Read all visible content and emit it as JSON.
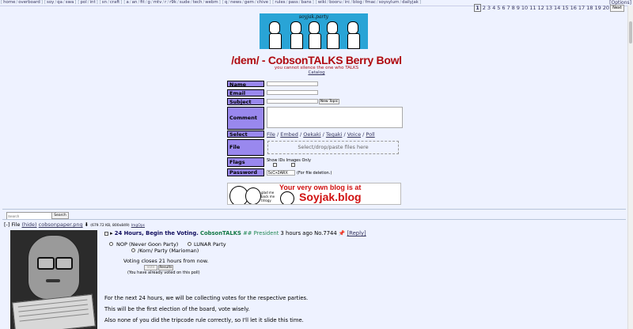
{
  "nav": {
    "groups": [
      [
        "home",
        "overboard"
      ],
      [
        "soy",
        "qa",
        "swa"
      ],
      [
        "pol",
        "int"
      ],
      [
        "sn",
        "craft"
      ],
      [
        "a",
        "an",
        "fit",
        "g",
        "mtv",
        "r",
        "r9k",
        "sude",
        "tech",
        "webm"
      ],
      [
        "q",
        "news",
        "gem",
        "chive"
      ],
      [
        "rules",
        "pass",
        "bans"
      ],
      [
        "wiki",
        "booru",
        "irc",
        "blog",
        "fmac",
        "soysylum",
        "dailyjak"
      ]
    ],
    "options_label": "[Options]",
    "pages": [
      "1",
      "2",
      "3",
      "4",
      "5",
      "6",
      "7",
      "8",
      "9",
      "10",
      "11",
      "12",
      "13",
      "14",
      "15",
      "16",
      "17",
      "18",
      "19",
      "20"
    ],
    "current_page": "1",
    "page_button": "Next"
  },
  "banner": {
    "text": "soyjak.party"
  },
  "board": {
    "title": "/dem/ - CobsonTALKS Berry Bowl",
    "subtitle": "you cannot silence the one who TALKS",
    "catalog_link": "Catalog"
  },
  "form": {
    "name_label": "Name",
    "email_label": "Email",
    "subject_label": "Subject",
    "new_topic_button": "New Topic",
    "comment_label": "Comment",
    "select_label": "Select",
    "select_links": [
      "File",
      "Embed",
      "Oekaki",
      "Tegaki",
      "Voice",
      "Poll"
    ],
    "file_label": "File",
    "dropzone_text": "Select/drop/paste files here",
    "flags_label": "Flags",
    "flags_text": "Show IDs   Images Only",
    "password_label": "Password",
    "password_value": "5cC+2ARX",
    "password_note": "(For file deletion.)"
  },
  "ad": {
    "headline": "Your very own blog is at",
    "brand": "Soyjak.blog",
    "small_text": "glad me back me trilogy"
  },
  "search": {
    "placeholder": "Search",
    "value": "",
    "button": "Search"
  },
  "thread": {
    "file_prefix": "File",
    "file_hide": "(hide)",
    "filename": "cobsonpaper.png",
    "file_meta": "(679.72 KB, 800x849)",
    "file_imgops": "ImgOps",
    "subject": "24 Hours, Begin the Voting.",
    "name": "CobsonTALKS",
    "tripcode": "## President",
    "time": "3 hours ago",
    "post_no": "No.7744",
    "reply_label": "[Reply]",
    "poll": {
      "options": [
        "NOP (Never Goon Party)",
        "LUNAR Party",
        "/Korn/ Party (Marioman)"
      ],
      "closes_text": "Voting closes 21 hours from now.",
      "vote_button": "Vote",
      "results_button": "Results",
      "voted_note": "(You have already voted on this poll)"
    },
    "body": [
      "For the next 24 hours, we will be collecting votes for the respective parties.",
      "This will be the first election of the board, vote wisely.",
      "Also none of you did the tripcode rule correctly, so I'll let it slide this time."
    ]
  }
}
